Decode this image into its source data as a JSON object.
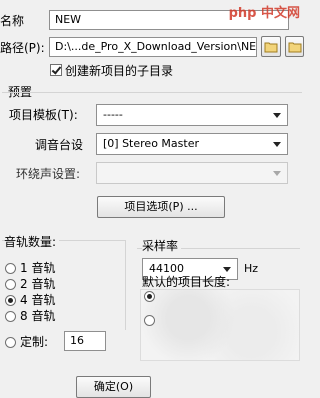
{
  "header": {
    "name_label": "名称",
    "name_value": "NEW",
    "path_label": "路径(P):",
    "path_value": "D:\\...de_Pro_X_Download_Version\\NEW",
    "subdir_checkbox_label": "创建新项目的子目录",
    "subdir_checked": true
  },
  "watermark": {
    "text": "php 中文网"
  },
  "preset": {
    "section_label": "预置",
    "template_label": "项目模板(T):",
    "template_value": "-----",
    "mixer_label": "调音台设",
    "mixer_value": "[0] Stereo Master",
    "surround_label": "环绕声设置:",
    "surround_value": "",
    "options_button": "项目选项(P) ..."
  },
  "tracks": {
    "label": "音轨数量:",
    "options": [
      "1 音轨",
      "2 音轨",
      "4 音轨",
      "8 音轨"
    ],
    "selected": "4 音轨",
    "custom_label": "定制:",
    "custom_value": "16"
  },
  "sample_rate": {
    "label": "采样率",
    "value": "44100",
    "unit": "Hz"
  },
  "length": {
    "label": "默认的项目长度:"
  },
  "footer": {
    "ok_button": "确定(O)"
  }
}
